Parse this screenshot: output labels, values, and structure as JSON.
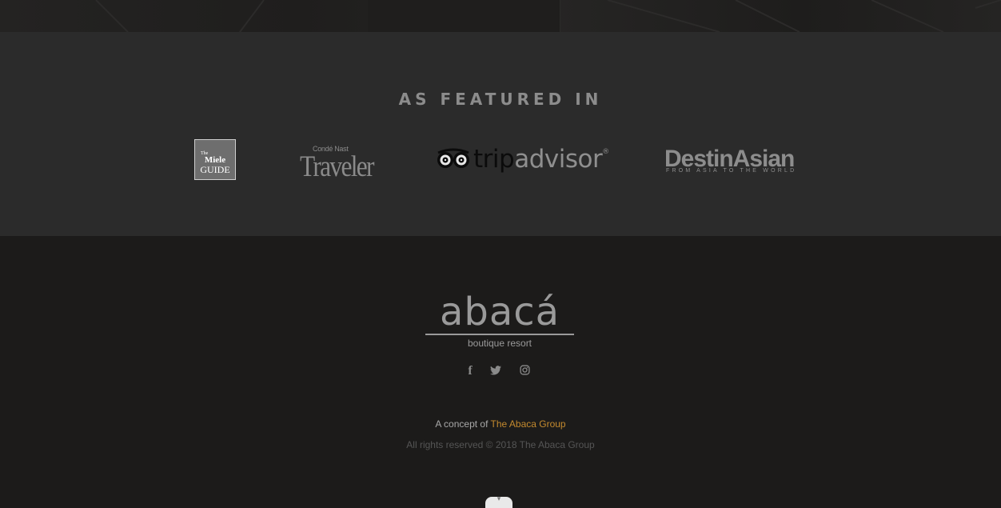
{
  "featured": {
    "heading": "AS FEATURED IN",
    "logos": {
      "miele": {
        "the": "The",
        "name": "Miele",
        "guide": "GUIDE"
      },
      "traveler": {
        "conde": "Condé Nast",
        "name": "Traveler"
      },
      "tripadvisor": {
        "trip": "trip",
        "advisor": "advisor",
        "reg": "®"
      },
      "destinasian": {
        "name": "DestinAsian",
        "tagline": "FROM ASIA TO THE WORLD"
      }
    }
  },
  "footer": {
    "brand": {
      "name": "abacá",
      "subtitle": "boutique resort"
    },
    "social": [
      {
        "icon": "facebook-icon",
        "glyph": "f"
      },
      {
        "icon": "twitter-icon",
        "glyph": "🐦"
      },
      {
        "icon": "instagram-icon",
        "glyph": "◎"
      }
    ],
    "concept_prefix": "A concept of",
    "concept_link": "The Abaca Group",
    "rights": "All rights reserved © 2018 The Abaca Group"
  },
  "scroll_tab": {
    "glyph": "▾",
    "icon": "chevron-down-icon"
  },
  "colors": {
    "accent": "#c48a2e",
    "featured_bg": "#2b2b2b",
    "footer_bg": "#1c1b1a"
  }
}
